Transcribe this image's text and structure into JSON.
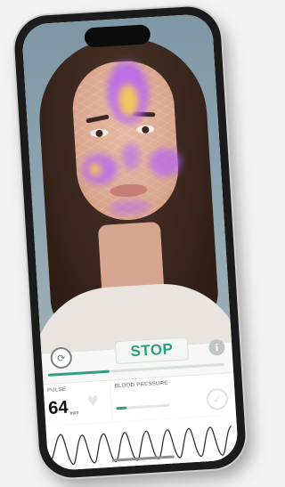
{
  "controls": {
    "stop_label": "STOP",
    "info_label": "i",
    "scan_progress_percent": 35
  },
  "pulse": {
    "label": "PULSE",
    "value": "64",
    "unit": "bpm"
  },
  "blood_pressure": {
    "label": "BLOOD PRESSURE",
    "progress_percent": 20
  },
  "colors": {
    "accent": "#2fa083",
    "heatmap": "#b05cff",
    "heatmap_hot": "#ffd447"
  },
  "icons": {
    "switch_camera": "camera-switch-icon",
    "info": "info-icon",
    "heart": "heart-icon",
    "status": "checkmark-icon"
  }
}
